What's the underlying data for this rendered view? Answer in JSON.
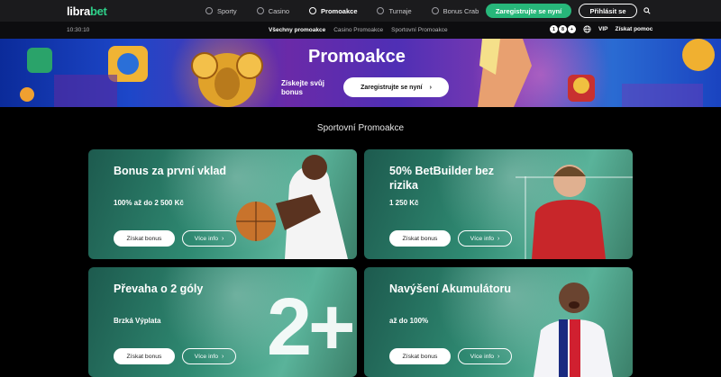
{
  "brand": {
    "name_part1": "libra",
    "name_part2": "bet",
    "accent_color": "#2fd08a"
  },
  "nav": {
    "items": [
      {
        "label": "Sporty",
        "icon": "ball-icon"
      },
      {
        "label": "Casino",
        "icon": "chip-icon"
      },
      {
        "label": "Promoakce",
        "icon": "promo-icon",
        "active": true
      },
      {
        "label": "Turnaje",
        "icon": "trophy-icon"
      },
      {
        "label": "Bonus Crab",
        "icon": "crab-icon"
      }
    ],
    "register_label": "Zaregistrujte se nyní",
    "login_label": "Přihlásit se"
  },
  "subbar": {
    "time": "10:30:10",
    "tabs": [
      "Všechny promoakce",
      "Casino Promoakce",
      "Sportovní Promoakce"
    ],
    "age_badges": [
      "1",
      "8",
      "+"
    ],
    "vip_label": "VIP",
    "help_label": "Získat pomoc"
  },
  "hero": {
    "title": "Promoakce",
    "subtitle": "Získejte svůj bonus",
    "button_label": "Zaregistrujte se nyní"
  },
  "section_title": "Sportovní Promoakce",
  "cards": [
    {
      "title": "Bonus za první vklad",
      "subtitle": "100% až do 2 500 Kč",
      "primary": "Získat bonus",
      "secondary": "Více info"
    },
    {
      "title": "50% BetBuilder bez rizika",
      "subtitle": "1 250 Kč",
      "primary": "Získat bonus",
      "secondary": "Více info"
    },
    {
      "title": "Převaha o 2 góly",
      "subtitle": "Brzká Výplata",
      "primary": "Získat bonus",
      "secondary": "Více info",
      "big": "2+"
    },
    {
      "title": "Navýšení Akumulátoru",
      "subtitle": "až do 100%",
      "primary": "Získat bonus",
      "secondary": "Více info"
    }
  ]
}
